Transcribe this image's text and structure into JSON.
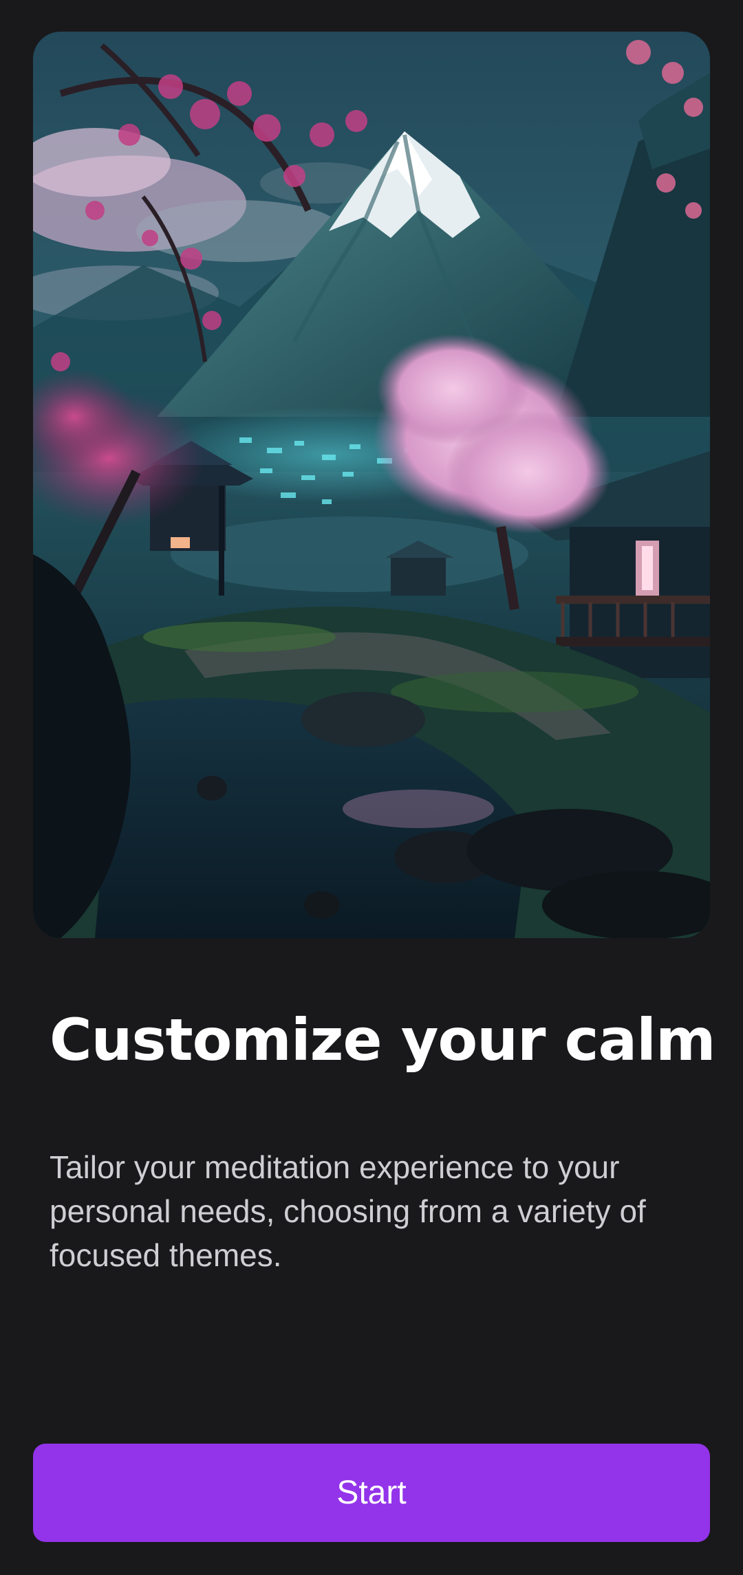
{
  "onboarding": {
    "title": "Customize your calm",
    "description": "Tailor your meditation experience to your personal needs, choosing from a variety of focused themes.",
    "start_label": "Start"
  },
  "colors": {
    "background": "#19191b",
    "accent": "#9333ea",
    "title": "#ffffff",
    "body_text": "#cfcfd3"
  }
}
